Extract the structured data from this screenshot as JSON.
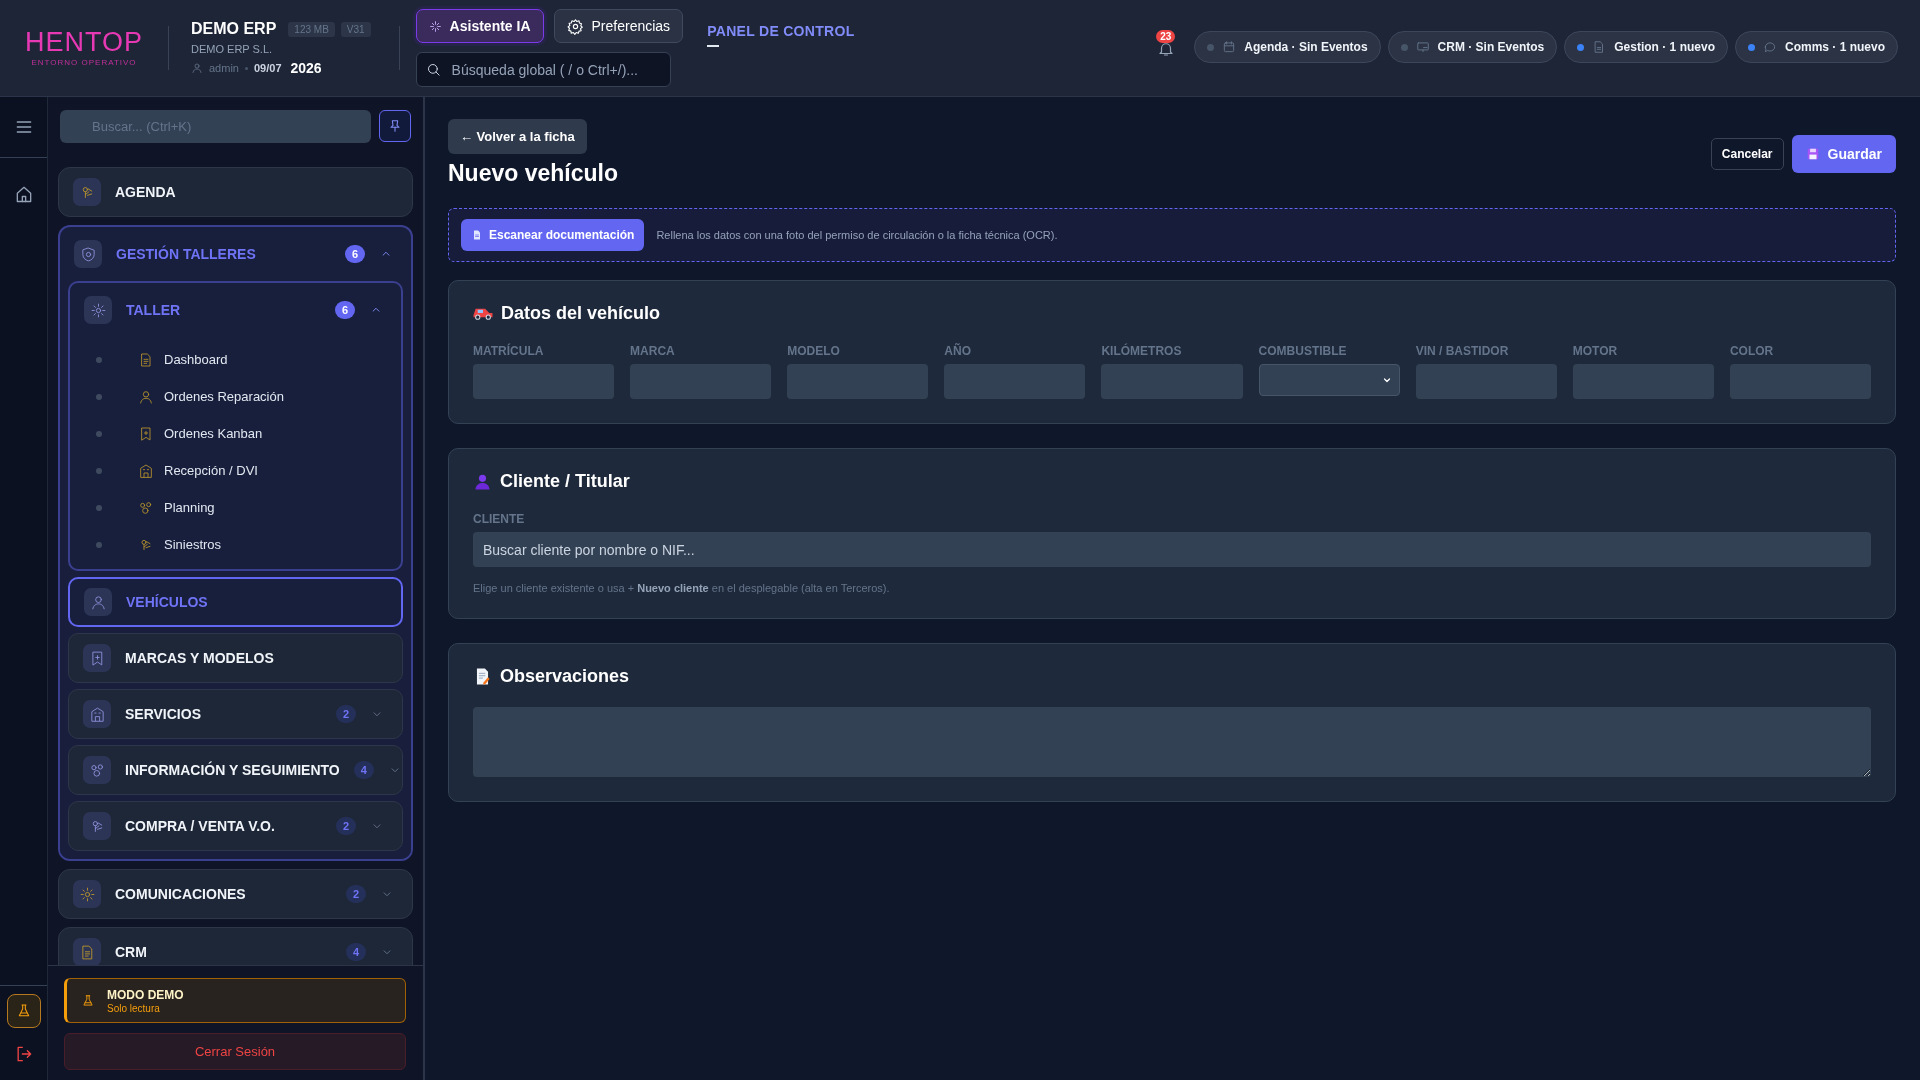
{
  "header": {
    "logo": {
      "text": "HENTOP",
      "tagline": "ENTORNO OPERATIVO"
    },
    "company": {
      "name": "DEMO ERP",
      "badges": [
        "123 MB",
        "V31"
      ],
      "legal_name": "DEMO ERP S.L.",
      "user": "admin",
      "date": "09/07",
      "year": "2026"
    },
    "assistant_button": "Asistente IA",
    "preferences_button": "Preferencias",
    "search": {
      "placeholder": "Búsqueda global ( / o Ctrl+/)..."
    },
    "panel_link": "PANEL DE CONTROL",
    "notifications": {
      "count": "23"
    },
    "chips": [
      {
        "label": "Agenda · Sin Eventos",
        "unread": false
      },
      {
        "label": "CRM · Sin Eventos",
        "unread": false
      },
      {
        "label": "Gestion · 1 nuevo",
        "unread": true
      },
      {
        "label": "Comms · 1 nuevo",
        "unread": true
      }
    ]
  },
  "sidebar": {
    "search": {
      "placeholder": "Buscar... (Ctrl+K)"
    },
    "items": [
      {
        "kind": "link",
        "label": "AGENDA",
        "selected": false
      },
      {
        "kind": "group",
        "label": "GESTIÓN TALLERES",
        "badge": "6",
        "expanded": true,
        "selected": false,
        "children": [
          {
            "kind": "group",
            "label": "TALLER",
            "badge": "6",
            "expanded": true,
            "selected": false,
            "children": [
              {
                "label": "Dashboard",
                "selected": false
              },
              {
                "label": "Ordenes Reparación",
                "selected": false
              },
              {
                "label": "Ordenes Kanban",
                "selected": false
              },
              {
                "label": "Recepción / DVI",
                "selected": false
              },
              {
                "label": "Planning",
                "selected": false
              },
              {
                "label": "Siniestros",
                "selected": false
              }
            ]
          },
          {
            "kind": "link",
            "label": "VEHÍCULOS",
            "selected": true
          },
          {
            "kind": "link",
            "label": "MARCAS Y MODELOS",
            "selected": false
          },
          {
            "kind": "group",
            "label": "SERVICIOS",
            "badge": "2",
            "expanded": false,
            "selected": false
          },
          {
            "kind": "group",
            "label": "INFORMACIÓN Y SEGUIMIENTO",
            "badge": "4",
            "expanded": false,
            "selected": false
          },
          {
            "kind": "group",
            "label": "COMPRA / VENTA V.O.",
            "badge": "2",
            "expanded": false,
            "selected": false
          }
        ]
      },
      {
        "kind": "group",
        "label": "COMUNICACIONES",
        "badge": "2",
        "expanded": false,
        "selected": false
      },
      {
        "kind": "group",
        "label": "CRM",
        "badge": "4",
        "expanded": false,
        "selected": false
      }
    ],
    "demo_mode": {
      "title": "MODO DEMO",
      "subtitle": "Solo lectura"
    },
    "logout_button": "Cerrar Sesión"
  },
  "page": {
    "back_button": "← Volver a la ficha",
    "title": "Nuevo vehículo",
    "cancel_button": "Cancelar",
    "save_button": "Guardar",
    "scan": {
      "button": "Escanear documentación",
      "hint": "Rellena los datos con una foto del permiso de circulación o la ficha técnica (OCR)."
    },
    "vehicle_card": {
      "title": "Datos del vehículo",
      "fields": [
        {
          "label": "MATRÍCULA",
          "kind": "text"
        },
        {
          "label": "MARCA",
          "kind": "text"
        },
        {
          "label": "MODELO",
          "kind": "text"
        },
        {
          "label": "AÑO",
          "kind": "text"
        },
        {
          "label": "KILÓMETROS",
          "kind": "text"
        },
        {
          "label": "COMBUSTIBLE",
          "kind": "select"
        },
        {
          "label": "VIN / BASTIDOR",
          "kind": "text"
        },
        {
          "label": "MOTOR",
          "kind": "text"
        },
        {
          "label": "COLOR",
          "kind": "text"
        }
      ]
    },
    "client_card": {
      "title": "Cliente / Titular",
      "field_label": "CLIENTE",
      "placeholder": "Buscar cliente por nombre o NIF...",
      "help": "Elige un cliente existente o usa + **Nuevo cliente** en el desplegable (alta en Terceros)."
    },
    "notes_card": {
      "title": "Observaciones"
    }
  }
}
